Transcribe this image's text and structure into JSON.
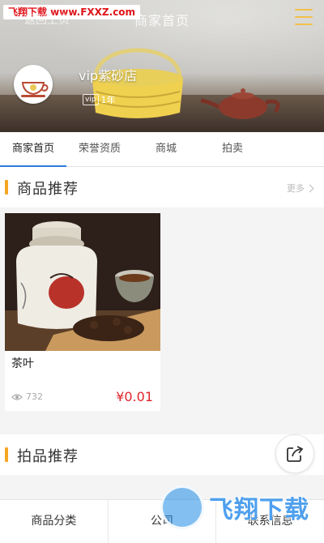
{
  "watermark_top": "飞翔下载 www.FXXZ.com",
  "header": {
    "back_label": "返回上页",
    "title": "商家首页"
  },
  "shop": {
    "name": "vip紫砂店",
    "vip_tag": "vip",
    "years": "1年"
  },
  "tabs": [
    {
      "label": "商家首页"
    },
    {
      "label": "荣誉资质"
    },
    {
      "label": "商城"
    },
    {
      "label": "拍卖"
    }
  ],
  "sections": {
    "products": {
      "title": "商品推荐",
      "more_label": "更多"
    },
    "auctions": {
      "title": "拍品推荐"
    }
  },
  "products": [
    {
      "name": "茶叶",
      "views": "732",
      "price": "¥0.01"
    }
  ],
  "bottom_nav": [
    {
      "label": "商品分类"
    },
    {
      "label": "公司"
    },
    {
      "label": "联系信息"
    }
  ],
  "watermark_bottom": "飞翔下载",
  "colors": {
    "accent_bar": "#f5a623",
    "active_tab": "#2f7bd8",
    "price": "#e0242b",
    "menu_icon": "#f2c04a"
  }
}
